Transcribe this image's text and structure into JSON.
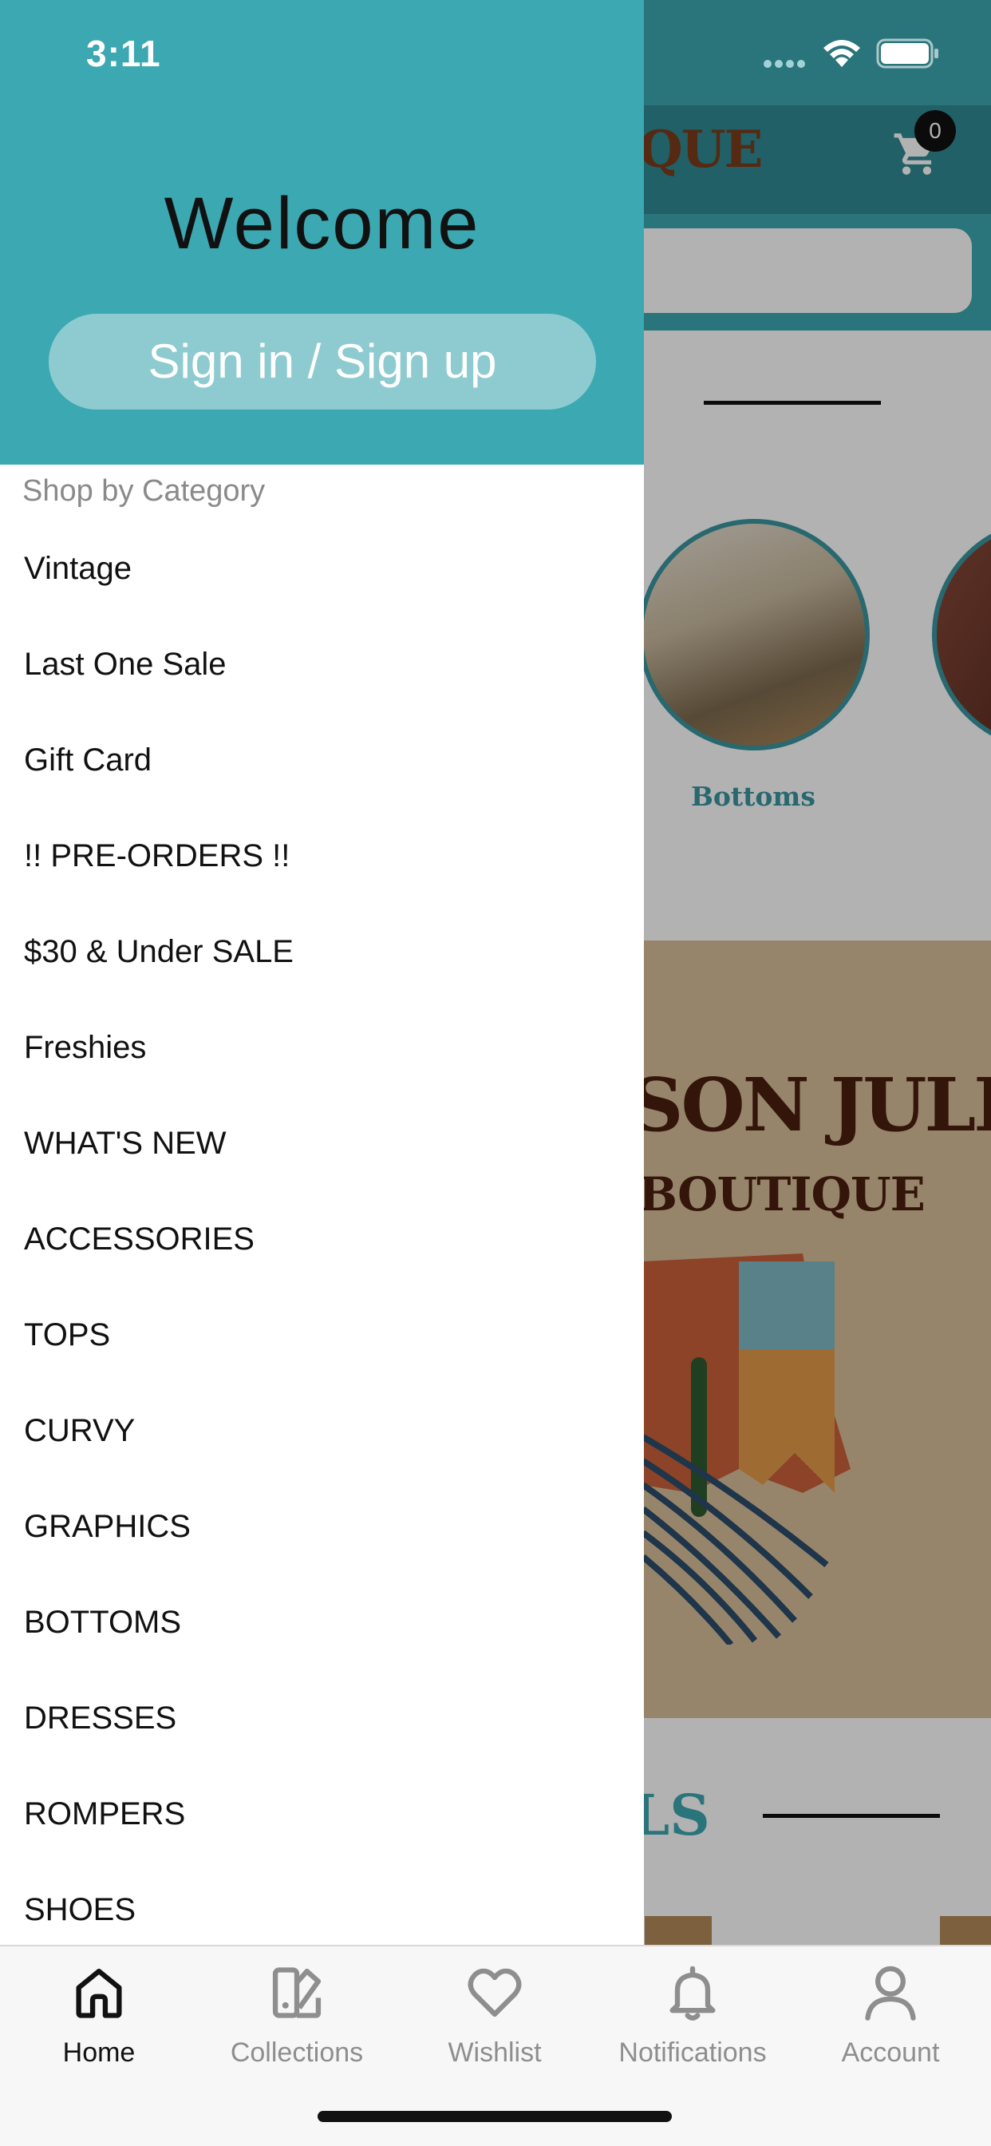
{
  "status_bar": {
    "time": "3:11"
  },
  "background": {
    "cart_count": "0",
    "header_logo_partial": "QUE",
    "circle_label": "Bottoms",
    "banner_title_partial": "SON JULES",
    "banner_subtitle_partial": "BOUTIQUE",
    "section_title_partial": "LS"
  },
  "drawer": {
    "welcome": "Welcome",
    "signin_label": "Sign in / Sign up",
    "category_heading": "Shop by Category",
    "categories": [
      "Vintage",
      "Last One Sale",
      "Gift Card",
      "!! PRE-ORDERS !!",
      "$30 & Under SALE",
      "Freshies",
      "WHAT'S NEW",
      "ACCESSORIES",
      "TOPS",
      "CURVY",
      "GRAPHICS",
      "BOTTOMS",
      "DRESSES",
      "ROMPERS",
      "SHOES"
    ]
  },
  "tabbar": {
    "tabs": [
      {
        "label": "Home",
        "icon": "home-icon",
        "active": true
      },
      {
        "label": "Collections",
        "icon": "collections-icon",
        "active": false
      },
      {
        "label": "Wishlist",
        "icon": "heart-icon",
        "active": false
      },
      {
        "label": "Notifications",
        "icon": "bell-icon",
        "active": false
      },
      {
        "label": "Account",
        "icon": "person-icon",
        "active": false
      }
    ]
  },
  "colors": {
    "brand_teal": "#3ca8b1",
    "signin_button": "#8ecbd0",
    "active_tab": "#111111",
    "inactive_tab": "#8e8e8e"
  }
}
